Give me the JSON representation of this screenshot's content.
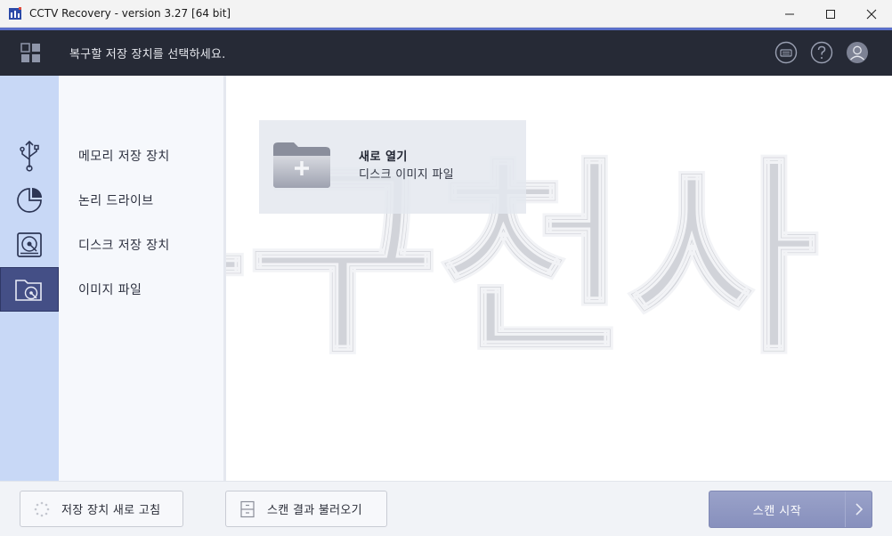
{
  "window": {
    "title": "CCTV Recovery - version 3.27 [64 bit]"
  },
  "header": {
    "message": "복구할 저장 장치를 선택하세요."
  },
  "categories": [
    {
      "label": "메모리 저장 장치"
    },
    {
      "label": "논리 드라이브"
    },
    {
      "label": "디스크 저장 장치"
    },
    {
      "label": "이미지 파일"
    }
  ],
  "main": {
    "watermark": "복구천사",
    "open_card": {
      "title": "새로 열기",
      "subtitle": "디스크 이미지 파일"
    }
  },
  "footer": {
    "refresh_label": "저장 장치 새로 고침",
    "load_label": "스캔 결과 불러오기",
    "scan_label": "스캔 시작"
  },
  "colors": {
    "accent": "#5a6fc9",
    "header_bg": "#262a36",
    "rail_bg": "#c8d8f6",
    "rail_active": "#444f86",
    "scan_button": "#8d96c2"
  },
  "icons": {
    "rail": [
      "usb-icon",
      "partition-icon",
      "disk-icon",
      "image-file-icon"
    ],
    "header": [
      "keyboard-icon",
      "help-icon",
      "user-icon"
    ]
  }
}
